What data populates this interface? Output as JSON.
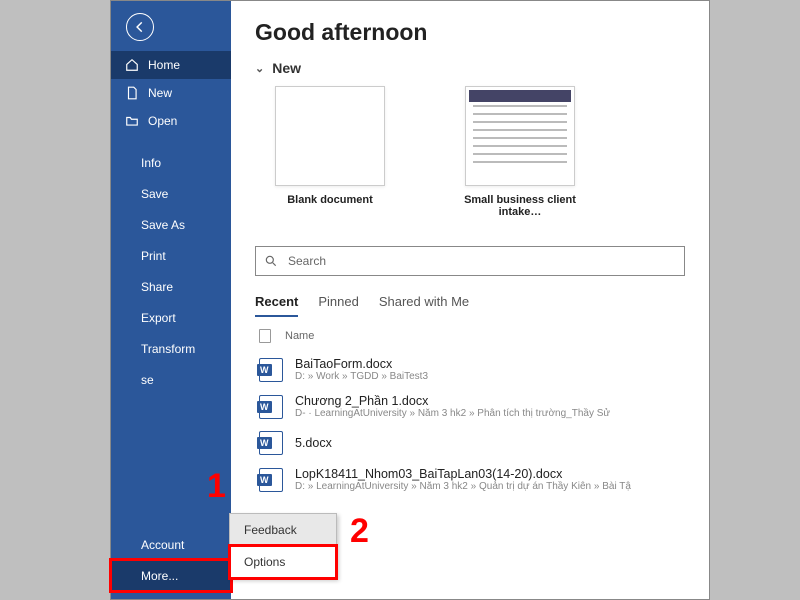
{
  "sidebar": {
    "primary": [
      {
        "label": "Home",
        "icon": "home",
        "active": true
      },
      {
        "label": "New",
        "icon": "doc"
      },
      {
        "label": "Open",
        "icon": "folder"
      }
    ],
    "secondary": [
      "Info",
      "Save",
      "Save As",
      "Print",
      "Share",
      "Export",
      "Transform",
      "se"
    ],
    "footer": [
      "Account",
      "More..."
    ]
  },
  "popup": {
    "items": [
      "Feedback",
      "Options"
    ]
  },
  "main": {
    "greeting": "Good afternoon",
    "new_label": "New",
    "templates": [
      {
        "name": "Blank document",
        "kind": "blank"
      },
      {
        "name": "Small business client intake…",
        "kind": "form"
      }
    ],
    "search_placeholder": "Search",
    "tabs": [
      "Recent",
      "Pinned",
      "Shared with Me"
    ],
    "active_tab": "Recent",
    "col_name": "Name",
    "files": [
      {
        "name": "BaiTaoForm.docx",
        "path": "D: » Work » TGDD » BaiTest3"
      },
      {
        "name": "Chương 2_Phần 1.docx",
        "path": "D- · LearningAtUniversity » Năm 3 hk2 » Phân tích thị trường_Thầy Sử"
      },
      {
        "name": "5.docx",
        "path": ""
      },
      {
        "name": "LopK18411_Nhom03_BaiTapLan03(14-20).docx",
        "path": "D: » LearningAtUniversity » Năm 3 hk2 » Quản trị dự án Thầy Kiên » Bài Tậ"
      }
    ]
  },
  "annotations": {
    "one": "1",
    "two": "2"
  }
}
